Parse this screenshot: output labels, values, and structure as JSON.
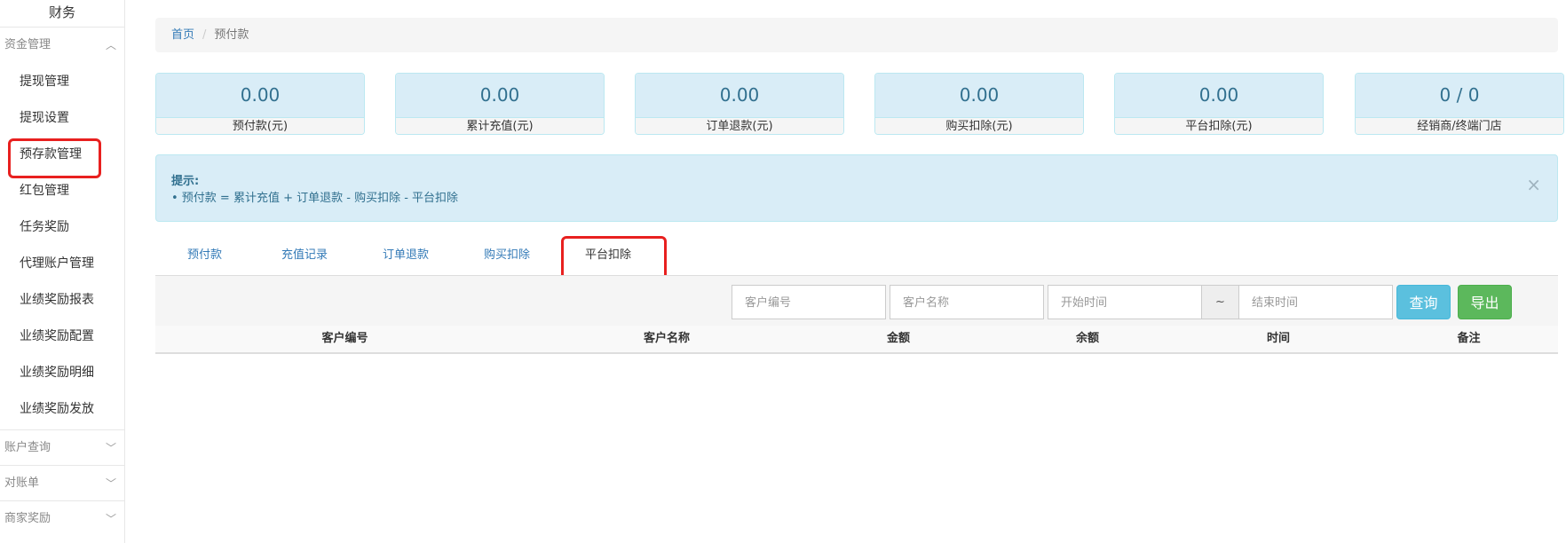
{
  "sidebar": {
    "title": "财务",
    "groups": [
      {
        "label": "资金管理",
        "chevron": "chevron-up-icon",
        "expanded": true
      },
      {
        "label": "账户查询",
        "chevron": "chevron-down-icon",
        "expanded": false
      },
      {
        "label": "对账单",
        "chevron": "chevron-down-icon",
        "expanded": false
      },
      {
        "label": "商家奖励",
        "chevron": "chevron-down-icon",
        "expanded": false
      }
    ],
    "items": [
      {
        "label": "提现管理"
      },
      {
        "label": "提现设置"
      },
      {
        "label": "预存款管理",
        "highlighted": true
      },
      {
        "label": "红包管理"
      },
      {
        "label": "任务奖励"
      },
      {
        "label": "代理账户管理"
      },
      {
        "label": "业绩奖励报表"
      },
      {
        "label": "业绩奖励配置"
      },
      {
        "label": "业绩奖励明细"
      },
      {
        "label": "业绩奖励发放"
      }
    ]
  },
  "breadcrumb": {
    "home": "首页",
    "separator": "/",
    "current": "预付款"
  },
  "stats": [
    {
      "value": "0.00",
      "label": "预付款(元)"
    },
    {
      "value": "0.00",
      "label": "累计充值(元)"
    },
    {
      "value": "0.00",
      "label": "订单退款(元)"
    },
    {
      "value": "0.00",
      "label": "购买扣除(元)"
    },
    {
      "value": "0.00",
      "label": "平台扣除(元)"
    },
    {
      "value": "0 / 0",
      "label": "经销商/终端门店"
    }
  ],
  "alert": {
    "title": "提示:",
    "text": "• 预付款 = 累计充值 + 订单退款 - 购买扣除 - 平台扣除",
    "close": "×"
  },
  "tabs": [
    {
      "label": "预付款"
    },
    {
      "label": "充值记录"
    },
    {
      "label": "订单退款"
    },
    {
      "label": "购买扣除"
    },
    {
      "label": "平台扣除",
      "active": true,
      "highlighted": true
    }
  ],
  "search": {
    "customer_id_placeholder": "客户编号",
    "customer_name_placeholder": "客户名称",
    "start_time_placeholder": "开始时间",
    "range_sep": "~",
    "end_time_placeholder": "结束时间",
    "query_label": "查询",
    "export_label": "导出"
  },
  "table": {
    "headers": [
      "客户编号",
      "客户名称",
      "金额",
      "余额",
      "时间",
      "备注"
    ],
    "rows": []
  },
  "colors": {
    "accent": "#337ab7",
    "info_bg": "#d9edf7",
    "info_text": "#31708f",
    "query_btn": "#5bc0de",
    "export_btn": "#5cb85c",
    "highlight_box": "#e8201f"
  }
}
